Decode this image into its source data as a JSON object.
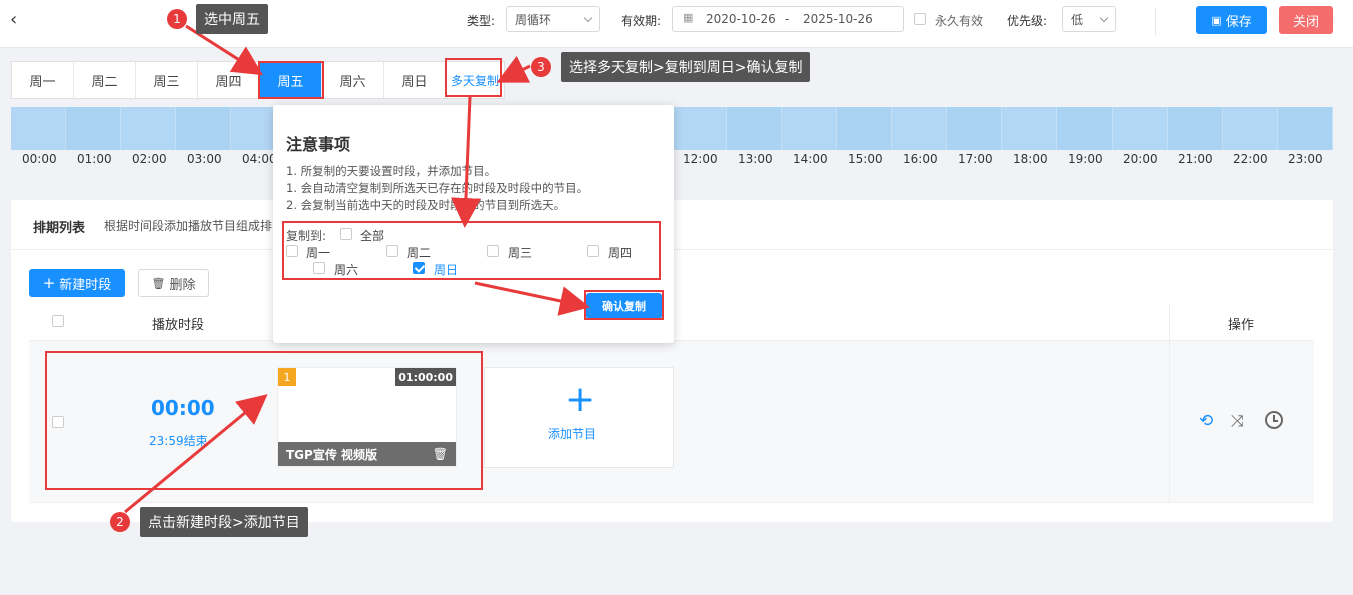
{
  "header": {
    "back_icon": "chevron-left-icon",
    "type_label": "类型:",
    "type_value": "周循环",
    "validity_label": "有效期:",
    "date_start": "2020-10-26",
    "date_sep": "-",
    "date_end": "2025-10-26",
    "permanent_label": "永久有效",
    "priority_label": "优先级:",
    "priority_value": "低",
    "save_label": "保存",
    "close_label": "关闭",
    "colors": {
      "primary": "#1890ff",
      "danger": "#f56c6c"
    }
  },
  "day_tabs": [
    {
      "label": "周一"
    },
    {
      "label": "周二"
    },
    {
      "label": "周三"
    },
    {
      "label": "周四"
    },
    {
      "label": "周五"
    },
    {
      "label": "周六"
    },
    {
      "label": "周日"
    },
    {
      "label": "多天复制"
    }
  ],
  "active_day": "周五",
  "timeline_hours": [
    "00:00",
    "01:00",
    "02:00",
    "03:00",
    "04:00",
    "12:00",
    "13:00",
    "14:00",
    "15:00",
    "16:00",
    "17:00",
    "18:00",
    "19:00",
    "20:00",
    "21:00",
    "22:00",
    "23:00"
  ],
  "schedule": {
    "title": "排期列表",
    "description": "根据时间段添加播放节目组成排",
    "new_label": "新建时段",
    "delete_label": "删除",
    "col_time": "播放时段",
    "col_ops": "操作",
    "slot": {
      "start": "00:00",
      "end": "23:59结束",
      "program_index": "1",
      "program_duration": "01:00:00",
      "program_name": "TGP宣传 视频版",
      "add_program_label": "添加节目"
    }
  },
  "popover": {
    "title": "注意事项",
    "notes": [
      "1. 所复制的天要设置时段，并添加节目。",
      "1. 会自动清空复制到所选天已存在的时段及时段中的节目。",
      "2. 会复制当前选中天的时段及时段中的节目到所选天。"
    ],
    "copy_to_label": "复制到:",
    "all_label": "全部",
    "days": [
      {
        "label": "周一",
        "checked": false
      },
      {
        "label": "周二",
        "checked": false
      },
      {
        "label": "周三",
        "checked": false
      },
      {
        "label": "周四",
        "checked": false
      },
      {
        "label": "周六",
        "checked": false
      },
      {
        "label": "周日",
        "checked": true
      }
    ],
    "confirm_label": "确认复制"
  },
  "annotations": [
    {
      "num": "1",
      "text": "选中周五"
    },
    {
      "num": "2",
      "text": "点击新建时段>添加节目"
    },
    {
      "num": "3",
      "text": "选择多天复制>复制到周日>确认复制"
    }
  ]
}
